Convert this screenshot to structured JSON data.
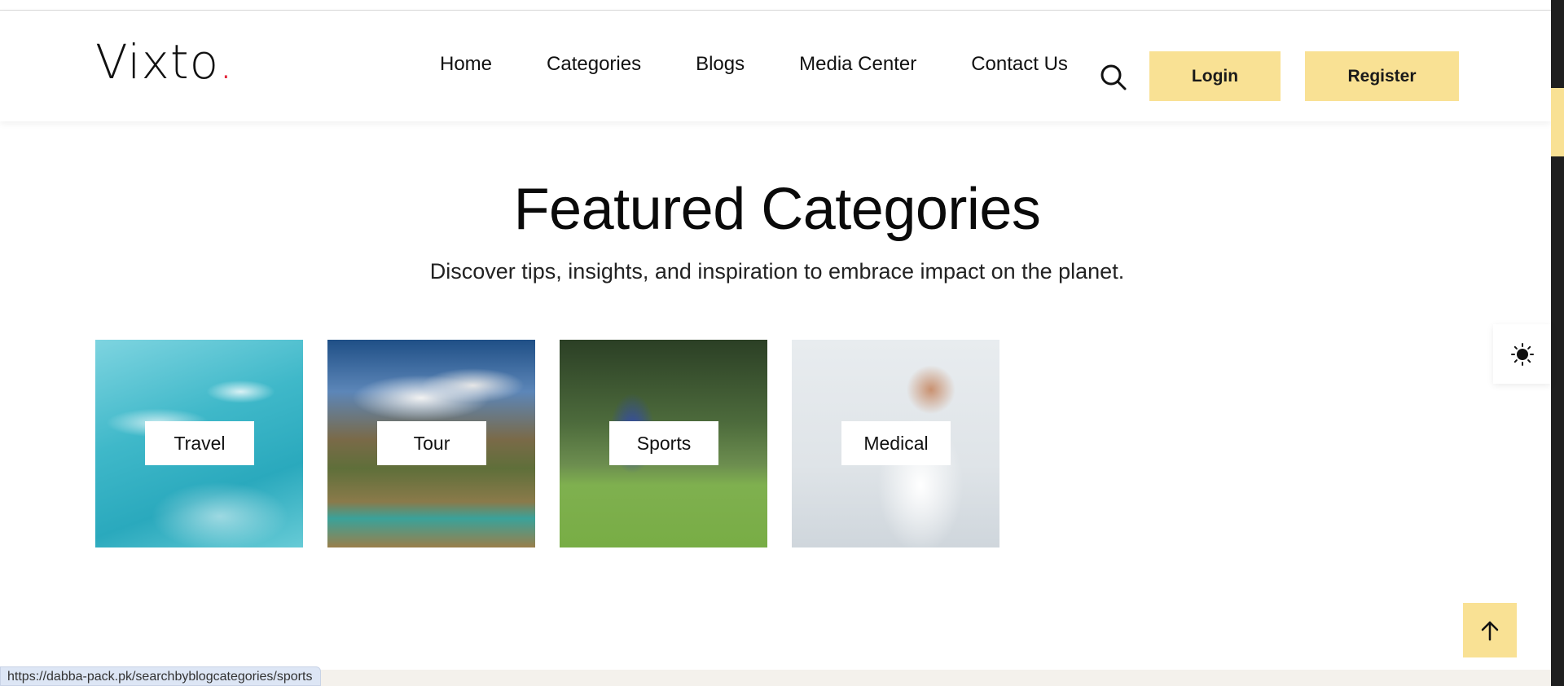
{
  "header": {
    "logo_text": "Vixto",
    "logo_dot": ".",
    "nav": [
      "Home",
      "Categories",
      "Blogs",
      "Media Center",
      "Contact Us"
    ],
    "search_icon": "search-icon",
    "login_label": "Login",
    "register_label": "Register"
  },
  "section": {
    "title": "Featured Categories",
    "subtitle": "Discover tips, insights, and inspiration to embrace impact on the planet."
  },
  "categories": [
    {
      "label": "Travel",
      "image": "surfers-on-wave"
    },
    {
      "label": "Tour",
      "image": "mountain-valley-river"
    },
    {
      "label": "Sports",
      "image": "cricket-batsman"
    },
    {
      "label": "Medical",
      "image": "smiling-doctor"
    }
  ],
  "theme_toggle_icon": "sun-icon",
  "back_to_top_icon": "arrow-up-icon",
  "status_bar": {
    "url": "https://dabba-pack.pk/searchbyblogcategories/sports"
  },
  "colors": {
    "accent": "#f9e194",
    "logo_dot": "#e3263b",
    "text": "#111111"
  }
}
